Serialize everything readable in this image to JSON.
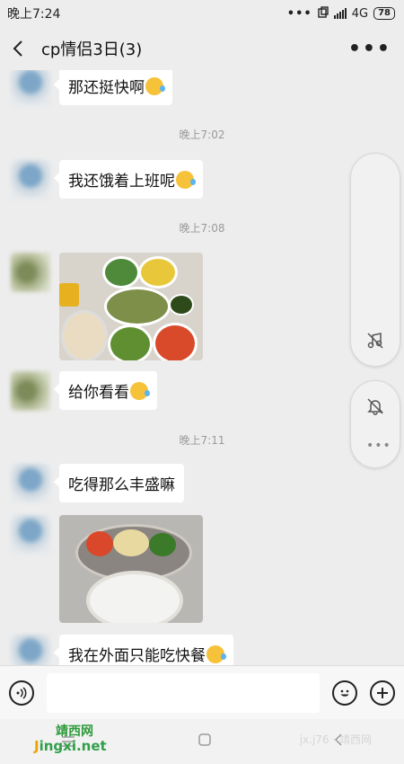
{
  "status_bar": {
    "time": "晚上7:24",
    "dots": "•••",
    "network": "4G",
    "battery": "78"
  },
  "header": {
    "title": "cp情侣3日(3)",
    "more": "•••"
  },
  "messages": [
    {
      "text": "那还挺快啊"
    },
    {
      "text": "我还饿着上班呢"
    },
    {
      "text": "给你看看"
    },
    {
      "text": "吃得那么丰盛嘛"
    },
    {
      "text": "我在外面只能吃快餐"
    }
  ],
  "timestamps": [
    "晚上7:02",
    "晚上7:08",
    "晚上7:11"
  ],
  "emojis": {
    "sweat_laugh": "😅",
    "joy": "😂"
  },
  "watermark": {
    "cn": "靖西网",
    "en_prefix": "J",
    "en_rest": "ingxi.net",
    "right": "jx.j76 · 靖西网"
  },
  "icons": {
    "back": "chevron-left-icon",
    "more": "more-dots-icon",
    "voice": "voice-icon",
    "emoji": "emoji-icon",
    "plus": "plus-icon",
    "music_off": "music-off-icon",
    "bell_off": "bell-off-icon",
    "menu": "menu-icon",
    "home": "home-icon",
    "nav_back": "nav-back-icon"
  },
  "colors": {
    "background": "#ededed",
    "bubble": "#ffffff",
    "emoji": "#f6c23a"
  }
}
